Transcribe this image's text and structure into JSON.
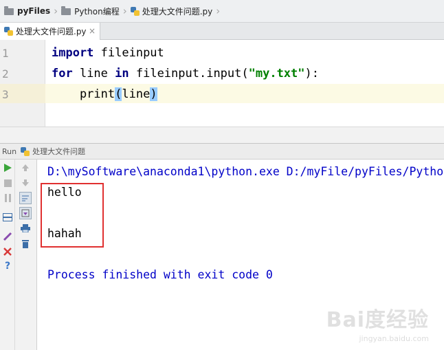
{
  "breadcrumb": {
    "items": [
      "pyFiles",
      "Python编程",
      "处理大文件问题.py"
    ]
  },
  "tab": {
    "label": "处理大文件问题.py",
    "close": "×"
  },
  "editor": {
    "line_numbers": [
      "1",
      "2",
      "3"
    ],
    "lines": {
      "l1_kw": "import",
      "l1_rest": " fileinput",
      "l2_kw1": "for",
      "l2_mid": " line ",
      "l2_kw2": "in",
      "l2_call": " fileinput.input(",
      "l2_str": "\"my.txt\"",
      "l2_end": "):",
      "l3_fn": "    print",
      "l3_open": "(",
      "l3_arg": "line",
      "l3_close": ")"
    }
  },
  "run": {
    "label": "Run",
    "config_name": "处理大文件问题"
  },
  "console": {
    "command": "D:\\mySoftware\\anaconda1\\python.exe D:/myFile/pyFiles/Pytho",
    "out1": "hello",
    "out2": "hahah",
    "exit": "Process finished with exit code 0"
  },
  "watermark": {
    "logo": "Bai度经验",
    "sub": "jingyan.baidu.com"
  },
  "colors": {
    "keyword": "#000080",
    "string": "#008000",
    "console_blue": "#0000c8",
    "highlight_box": "#e03030"
  }
}
